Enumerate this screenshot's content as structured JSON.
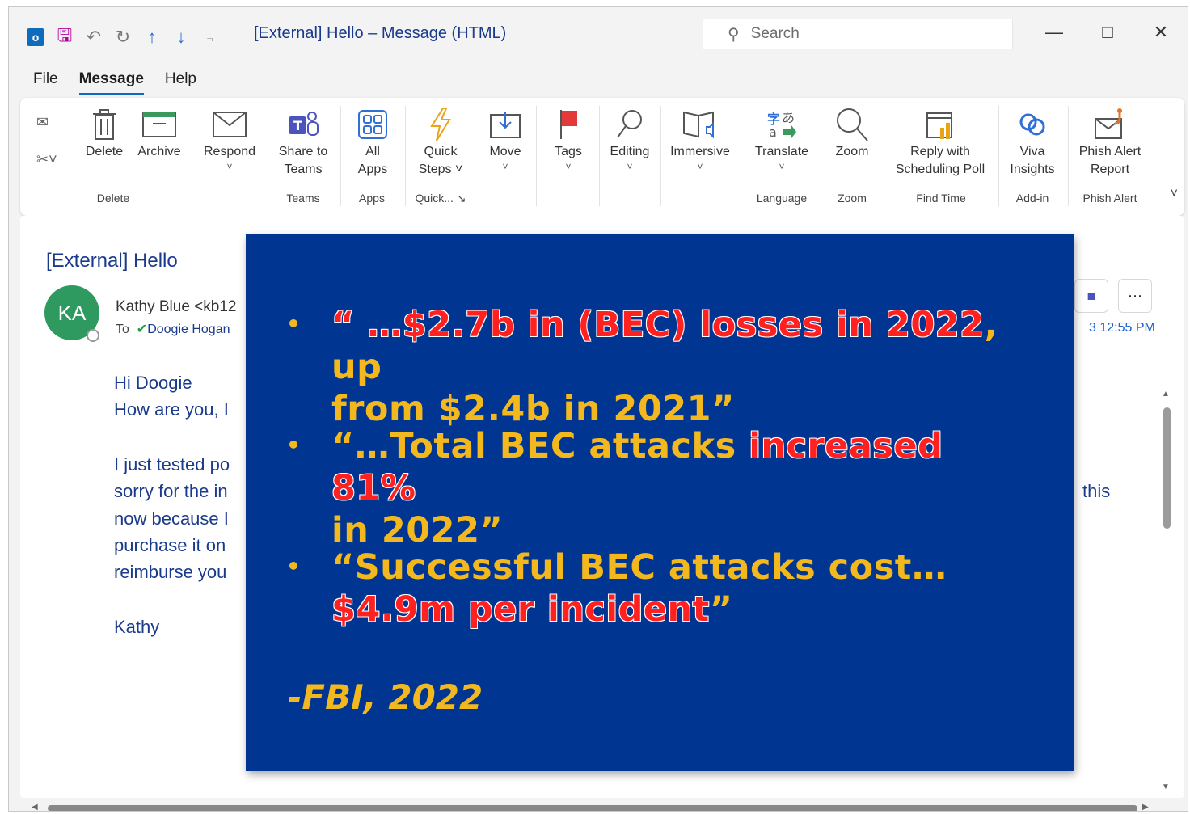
{
  "window": {
    "title": "[External] Hello – Message (HTML)",
    "search_placeholder": "Search",
    "app_letter": "o"
  },
  "menu": {
    "tabs": [
      {
        "label": "File",
        "active": false
      },
      {
        "label": "Message",
        "active": true
      },
      {
        "label": "Help",
        "active": false
      }
    ]
  },
  "ribbon": {
    "buttons": {
      "delete": "Delete",
      "archive": "Archive",
      "respond": "Respond",
      "share_teams_1": "Share to",
      "share_teams_2": "Teams",
      "all_apps_1": "All",
      "all_apps_2": "Apps",
      "quick_steps_1": "Quick",
      "quick_steps_2": "Steps",
      "move": "Move",
      "tags": "Tags",
      "editing": "Editing",
      "immersive": "Immersive",
      "translate": "Translate",
      "zoom": "Zoom",
      "reply_poll_1": "Reply with",
      "reply_poll_2": "Scheduling Poll",
      "viva_1": "Viva",
      "viva_2": "Insights",
      "phish_1": "Phish Alert",
      "phish_2": "Report"
    },
    "groups": {
      "delete": "Delete",
      "teams": "Teams",
      "apps": "Apps",
      "quick": "Quick...",
      "language": "Language",
      "zoom": "Zoom",
      "find_time": "Find Time",
      "add_in": "Add-in",
      "phish_alert": "Phish Alert"
    }
  },
  "message": {
    "subject": "[External] Hello",
    "avatar_initials": "KA",
    "sender": "Kathy Blue <kb12",
    "to_label": "To",
    "recipient": "Doogie Hogan",
    "time_fragment": "3 12:55 PM",
    "body": {
      "greeting": "Hi Doogie",
      "line1": "How are you, I",
      "line2": "I just tested po",
      "line3": "sorry for the in",
      "line3_right": "this",
      "line4": "now because I",
      "line5": "purchase it on",
      "line6": "reimburse you",
      "signoff": "Kathy"
    }
  },
  "overlay": {
    "bullets": [
      {
        "line1_parts": [
          {
            "text": "“ …$2.7b in (BEC) losses in 2022",
            "highlight": true
          },
          {
            "text": ", up",
            "highlight": false
          }
        ],
        "line2": "from $2.4b in 2021”"
      },
      {
        "line1_parts": [
          {
            "text": "“…Total BEC attacks ",
            "highlight": false
          },
          {
            "text": "increased 81%",
            "highlight": true
          }
        ],
        "line2": "in 2022”"
      },
      {
        "line1_parts": [
          {
            "text": "“Successful  BEC  attacks  cost…",
            "highlight": false
          }
        ],
        "line2_parts": [
          {
            "text": "$4.9m  per incident",
            "highlight": true
          },
          {
            "text": "”",
            "highlight": false
          }
        ]
      }
    ],
    "attribution": "-FBI, 2022"
  },
  "colors": {
    "overlay_bg": "#003591",
    "overlay_text": "#f3b81e",
    "overlay_highlight": "#ff2020",
    "accent": "#0f6cbd",
    "body_text": "#1a3a8c"
  }
}
